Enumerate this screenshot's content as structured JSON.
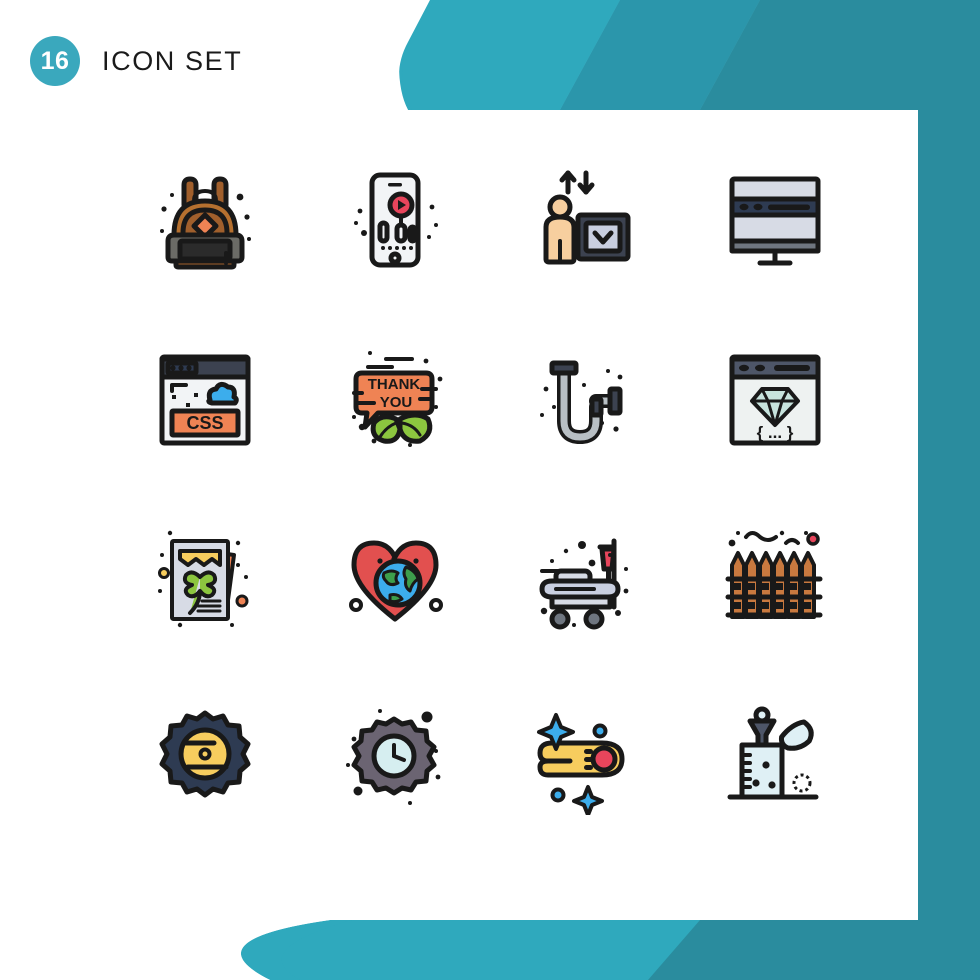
{
  "header": {
    "count": "16",
    "title": "Icon Set"
  },
  "colors": {
    "teal_light": "#2fa9bd",
    "teal_mid": "#2b96ab",
    "teal_dark": "#2a8c9e",
    "badge": "#3aa8bd",
    "outline": "#191919",
    "orange": "#ef8354",
    "orange_deep": "#e8713e",
    "yellow": "#f7cd5e",
    "red": "#e8455c",
    "green": "#8cc63f",
    "brown": "#a05f2c",
    "blue": "#3cadec",
    "grey_light": "#d7dbe5",
    "skin": "#f7cf9f",
    "navy": "#2e3b52"
  },
  "icons": [
    {
      "id": 1,
      "name": "backpack-icon",
      "label": "Backpack"
    },
    {
      "id": 2,
      "name": "mobile-music-player-icon",
      "label": "Mobile Music Player"
    },
    {
      "id": 3,
      "name": "person-upload-download-icon",
      "label": "Person Upload Download"
    },
    {
      "id": 4,
      "name": "desktop-monitor-icon",
      "label": "Desktop Monitor"
    },
    {
      "id": 5,
      "name": "css-browser-icon",
      "label": "CSS Browser Window",
      "text": "CSS"
    },
    {
      "id": 6,
      "name": "thank-you-leaf-icon",
      "label": "Thank You Speech Bubble",
      "text_line1": "THANK",
      "text_line2": "YOU"
    },
    {
      "id": 7,
      "name": "pipe-plumbing-icon",
      "label": "Plumbing Pipe"
    },
    {
      "id": 8,
      "name": "diamond-code-browser-icon",
      "label": "Diamond Code Browser",
      "text": "{ ... }"
    },
    {
      "id": 9,
      "name": "clover-certificate-icon",
      "label": "Clover Certificate Document"
    },
    {
      "id": 10,
      "name": "heart-globe-icon",
      "label": "Heart With Globe"
    },
    {
      "id": 11,
      "name": "hospital-stretcher-icon",
      "label": "Hospital Stretcher With IV"
    },
    {
      "id": 12,
      "name": "wooden-fence-icon",
      "label": "Wooden Fence"
    },
    {
      "id": 13,
      "name": "gear-cog-icon",
      "label": "Gear Cog"
    },
    {
      "id": 14,
      "name": "gear-clock-icon",
      "label": "Gear With Clock"
    },
    {
      "id": 15,
      "name": "comet-meteor-icon",
      "label": "Comet Meteor"
    },
    {
      "id": 16,
      "name": "lab-funnel-beaker-icon",
      "label": "Laboratory Funnel And Beaker"
    }
  ]
}
